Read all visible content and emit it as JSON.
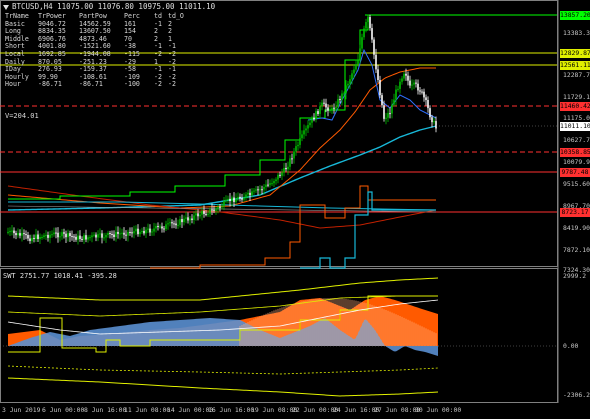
{
  "header": {
    "symbol_line": "BTCUSD,H4  11075.00 11076.80 10975.00 11011.10"
  },
  "stats_table": {
    "headers": [
      "TrName",
      "TrPower",
      "PartPow",
      "Perc",
      "td",
      "td_O"
    ],
    "rows": [
      [
        "Basic",
        "9046.72",
        "14562.59",
        "161",
        "-1",
        "2"
      ],
      [
        "Long",
        "8834.35",
        "13607.50",
        "154",
        "2",
        "2"
      ],
      [
        "Middle",
        "6906.76",
        "4873.46",
        "70",
        "2",
        "1"
      ],
      [
        "Short",
        "4001.80",
        "-1521.60",
        "-38",
        "-1",
        "-1"
      ],
      [
        "Local",
        "1692.85",
        "-1944.08",
        "-115",
        "-2",
        "-2"
      ],
      [
        "Daily",
        "870.05",
        "-251.23",
        "-29",
        "1",
        "-2"
      ],
      [
        "IDay",
        "276.93",
        "-159.37",
        "-58",
        "-1",
        "-1"
      ],
      [
        "Hourly",
        "99.90",
        "-108.61",
        "-109",
        "-2",
        "-2"
      ],
      [
        "Hour",
        "-86.71",
        "-86.71",
        "-100",
        "-2",
        "-2"
      ]
    ],
    "v_line": "V=204.01"
  },
  "price_axis": {
    "labels": [
      "13383.30",
      "12729.10",
      "12287.70",
      "11729.15",
      "11175.00",
      "10627.70",
      "10079.90",
      "9515.60",
      "8967.70",
      "8419.90",
      "7872.10",
      "7324.30"
    ]
  },
  "price_tags": [
    {
      "text": "13857.20",
      "bg": "#00ff00"
    },
    {
      "text": "12829.87",
      "bg": "#e0f000"
    },
    {
      "text": "12561.11",
      "bg": "#e0f000"
    },
    {
      "text": "11460.42",
      "bg": "#ff3030"
    },
    {
      "text": "11011.10",
      "bg": "#ffffff"
    },
    {
      "text": "10358.85",
      "bg": "#ff3030"
    },
    {
      "text": "9787.48",
      "bg": "#ff3030"
    },
    {
      "text": "8723.17",
      "bg": "#ff3030"
    }
  ],
  "subwindow": {
    "header": "SWT 2751.77 1018.41 -395.28",
    "axis_labels": [
      "2999.2",
      "0.00",
      "-2306.2"
    ]
  },
  "time_axis": {
    "labels": [
      "3 Jun 2019",
      "6 Jun 00:00",
      "8 Jun 16:00",
      "11 Jun 08:00",
      "14 Jun 00:00",
      "16 Jun 16:00",
      "19 Jun 08:00",
      "22 Jun 00:00",
      "24 Jun 16:00",
      "27 Jun 08:00",
      "30 Jun 00:00"
    ]
  },
  "colors": {
    "background": "#000000",
    "bull_candle": "#00c000",
    "bear_candle": "#ffffff",
    "teal_line": "#18b8d8",
    "green_line": "#00ff00",
    "yellow_line": "#e0f000",
    "red_line": "#ff3030",
    "orange_fill": "#ff5a00",
    "blue_fill": "#5a8fd0"
  }
}
